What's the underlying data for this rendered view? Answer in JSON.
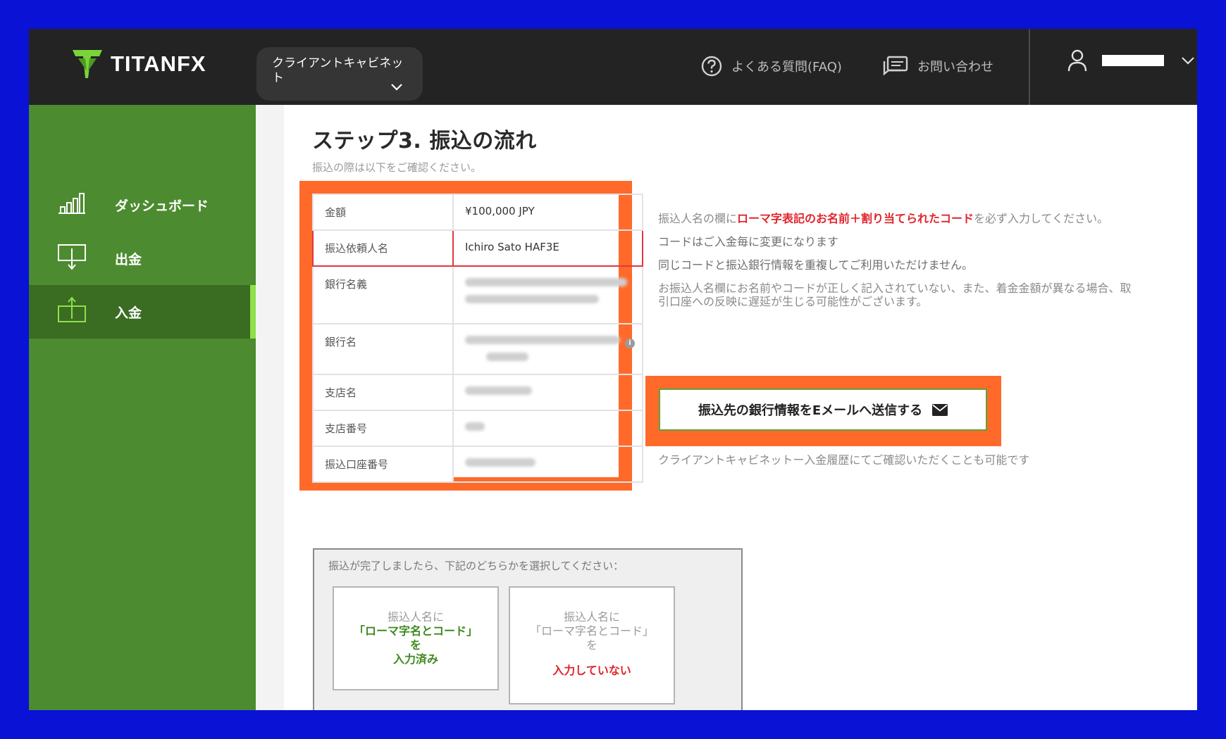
{
  "header": {
    "logo_text": "TITANFX",
    "cabinet_dropdown": "クライアントキャビネット",
    "faq_label": "よくある質問(FAQ)",
    "contact_label": "お問い合わせ"
  },
  "sidebar": {
    "items": [
      {
        "label": "ダッシュボード",
        "icon": "bar-chart-icon"
      },
      {
        "label": "出金",
        "icon": "withdraw-icon"
      },
      {
        "label": "入金",
        "icon": "deposit-icon",
        "active": true
      }
    ]
  },
  "main": {
    "title": "ステップ3. 振込の流れ",
    "subtitle": "振込の際は以下をご確認ください。",
    "table": [
      {
        "label": "金額",
        "value": "¥100,000 JPY"
      },
      {
        "label": "振込依頼人名",
        "value": "Ichiro Sato HAF3E"
      },
      {
        "label": "銀行名義",
        "value": ""
      },
      {
        "label": "銀行名",
        "value": ""
      },
      {
        "label": "支店名",
        "value": ""
      },
      {
        "label": "支店番号",
        "value": ""
      },
      {
        "label": "振込口座番号",
        "value": ""
      }
    ],
    "notes": {
      "line1_prefix": "振込人名の欄に",
      "line1_highlight": "ローマ字表記のお名前＋割り当てられたコード",
      "line1_suffix": "を必ず入力してください。",
      "line2": "コードはご入金毎に変更になります",
      "line3": "同じコードと振込銀行情報を重複してご利用いただけません。",
      "line4": "お振込人名欄にお名前やコードが正しく記入されていない、また、着金金額が異なる場合、取引口座への反映に遅延が生じる可能性がございます。"
    },
    "email_button": "振込先の銀行情報をEメールへ送信する",
    "confirm_note": "クライアントキャビネットー入金履歴にてご確認いただくことも可能です",
    "choice_prompt": "振込が完了しましたら、下記のどちらかを選択してください：",
    "choice_a": {
      "line1": "振込人名に",
      "line2": "「ローマ字名とコード」",
      "line3": "を",
      "line4": "入力済み"
    },
    "choice_b": {
      "line1": "振込人名に",
      "line2": "「ローマ字名とコード」",
      "line3": "を",
      "line4": "入力していない"
    }
  },
  "colors": {
    "background_frame": "#0a12d6",
    "header": "#232323",
    "sidebar": "#4c8b2f",
    "sidebar_active": "#3a6c22",
    "highlight": "#ff6a2b",
    "red_text": "#e0242b",
    "green_text": "#3f8a1f"
  }
}
